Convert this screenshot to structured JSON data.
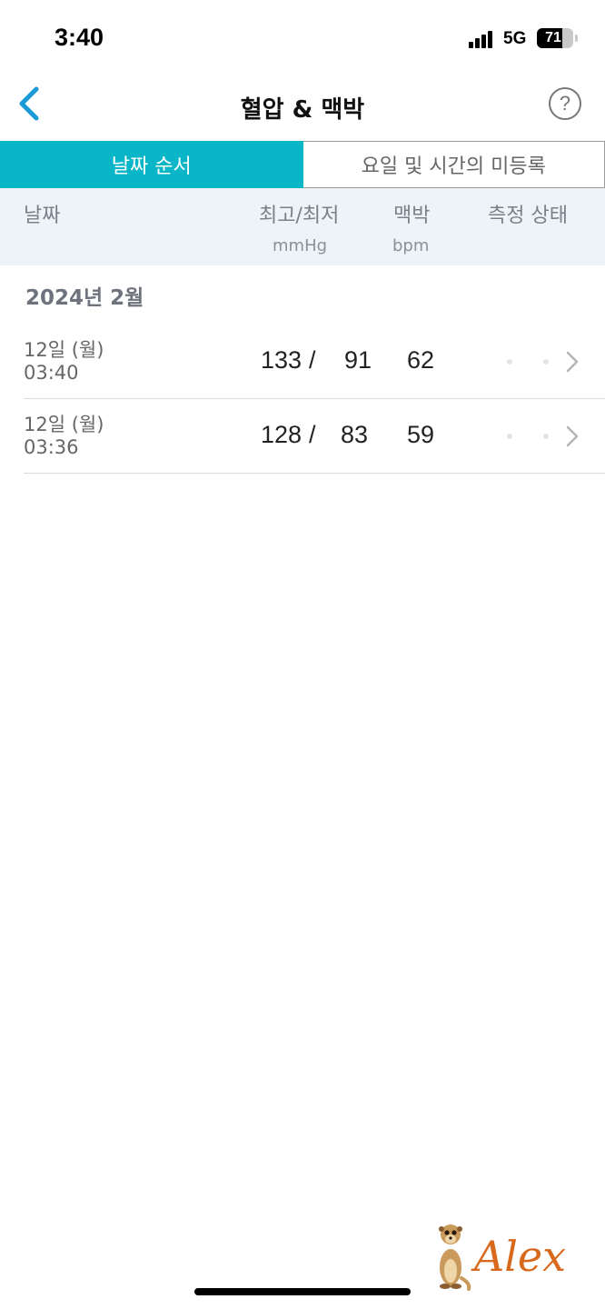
{
  "status_bar": {
    "time": "3:40",
    "network": "5G",
    "battery": "71",
    "battery_level": 0.71
  },
  "nav": {
    "back_icon": "chevron-left-icon",
    "title": "혈압 & 맥박",
    "help_icon": "question-circle-icon",
    "help_glyph": "?"
  },
  "segments": {
    "active_label": "날짜 순서",
    "inactive_label": "요일 및 시간의 미등록"
  },
  "colors": {
    "accent": "#08b6c8",
    "back_icon": "#1a9bd7",
    "header_bg": "#eef3f8"
  },
  "table": {
    "headers": {
      "date": "날짜",
      "sys_dia": "최고/최저",
      "sys_dia_unit": "mmHg",
      "pulse": "맥박",
      "pulse_unit": "bpm",
      "status": "측정 상태"
    },
    "month": "2024년 2월",
    "rows": [
      {
        "day": "12일 (월)",
        "time": "03:40",
        "sys": "133",
        "slash": "/",
        "dia": "91",
        "pulse": "62"
      },
      {
        "day": "12일 (월)",
        "time": "03:36",
        "sys": "128",
        "slash": "/",
        "dia": "83",
        "pulse": "59"
      }
    ]
  },
  "watermark": {
    "text": "Alex",
    "icon": "meerkat-icon"
  }
}
